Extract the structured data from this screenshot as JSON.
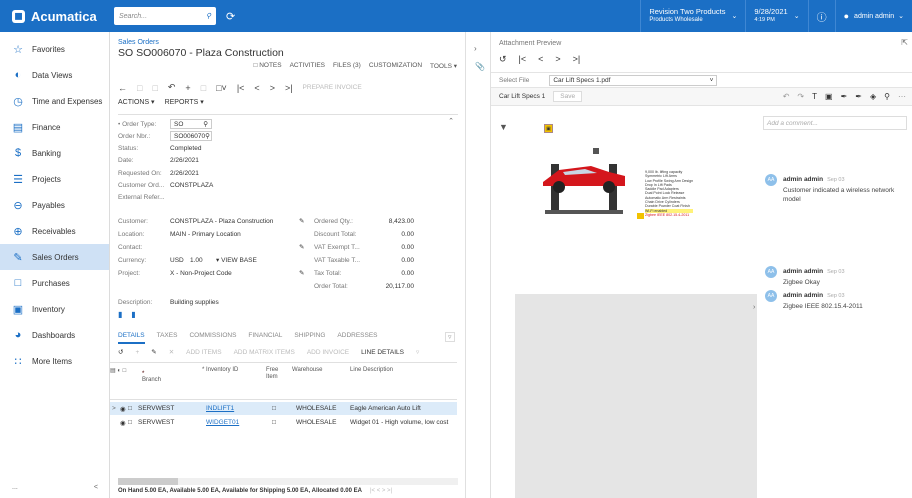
{
  "topbar": {
    "logo": "Acumatica",
    "search_placeholder": "Search...",
    "company_line1": "Revision Two Products",
    "company_line2": "Products Wholesale",
    "date_line1": "9/28/2021",
    "date_line2": "4:19 PM",
    "user": "admin admin"
  },
  "sidebar": {
    "items": [
      {
        "label": "Favorites",
        "icon": "star-icon"
      },
      {
        "label": "Data Views",
        "icon": "data-views-icon"
      },
      {
        "label": "Time and Expenses",
        "icon": "clock-icon"
      },
      {
        "label": "Finance",
        "icon": "finance-icon"
      },
      {
        "label": "Banking",
        "icon": "dollar-icon"
      },
      {
        "label": "Projects",
        "icon": "projects-icon"
      },
      {
        "label": "Payables",
        "icon": "minus-circle-icon"
      },
      {
        "label": "Receivables",
        "icon": "plus-circle-icon"
      },
      {
        "label": "Sales Orders",
        "icon": "edit-icon"
      },
      {
        "label": "Purchases",
        "icon": "cart-icon"
      },
      {
        "label": "Inventory",
        "icon": "truck-icon"
      },
      {
        "label": "Dashboards",
        "icon": "dashboard-icon"
      },
      {
        "label": "More Items",
        "icon": "grid-icon"
      }
    ],
    "footer_dots": "...",
    "collapse": "<"
  },
  "form": {
    "breadcrumb": "Sales Orders",
    "title": "SO SO006070 - Plaza Construction",
    "top_tabs": [
      "NOTES",
      "ACTIVITIES",
      "FILES (3)",
      "CUSTOMIZATION",
      "TOOLS ▾"
    ],
    "toolbar_prepare": "PREPARE INVOICE",
    "menu_actions": "ACTIONS ▾",
    "menu_reports": "REPORTS ▾",
    "order_type_label": "• Order Type:",
    "order_type": "SO",
    "order_nbr_label": "Order Nbr.:",
    "order_nbr": "SO006070",
    "status_label": "Status:",
    "status": "Completed",
    "date_label": "Date:",
    "date": "2/26/2021",
    "requested_label": "Requested On:",
    "requested": "2/26/2021",
    "customer_ord_label": "Customer Ord...",
    "customer_ord": "CONSTPLAZA",
    "external_label": "External Refer...",
    "customer_label": "Customer:",
    "customer": "CONSTPLAZA - Plaza Construction",
    "location_label": "Location:",
    "location": "MAIN - Primary Location",
    "contact_label": "Contact:",
    "currency_label": "Currency:",
    "currency": "USD",
    "rate": "1.00",
    "view_base": "▾ VIEW BASE",
    "project_label": "Project:",
    "project": "X - Non-Project Code",
    "description_label": "Description:",
    "description": "Building supplies",
    "totals": [
      {
        "label": "Ordered Qty.:",
        "value": "8,423.00"
      },
      {
        "label": "Discount Total:",
        "value": "0.00"
      },
      {
        "label": "VAT Exempt T...",
        "value": "0.00"
      },
      {
        "label": "VAT Taxable T...",
        "value": "0.00"
      },
      {
        "label": "Tax Total:",
        "value": "0.00"
      },
      {
        "label": "Order Total:",
        "value": "20,117.00"
      }
    ]
  },
  "grid": {
    "tabs": [
      "DETAILS",
      "TAXES",
      "COMMISSIONS",
      "FINANCIAL",
      "SHIPPING",
      "ADDRESSES"
    ],
    "tools": [
      "ADD ITEMS",
      "ADD MATRIX ITEMS",
      "ADD INVOICE"
    ],
    "line_details": "LINE DETAILS",
    "columns": [
      "* Branch",
      "* Inventory ID",
      "Free Item",
      "Warehouse",
      "Line Description"
    ],
    "rows": [
      {
        "branch": "SERVWEST",
        "inventory": "INDLIFT1",
        "warehouse": "WHOLESALE",
        "desc": "Eagle American Auto Lift"
      },
      {
        "branch": "SERVWEST",
        "inventory": "WIDGET01",
        "warehouse": "WHOLESALE",
        "desc": "Widget 01 - High volume, low cost"
      }
    ],
    "status_bar": "On Hand 5.00 EA, Available 5.00 EA, Available for Shipping 5.00 EA, Allocated 0.00 EA"
  },
  "preview": {
    "title": "Attachment Preview",
    "select_file_label": "Select File",
    "selected_file": "Car Lift Specs 1.pdf",
    "tab": "Car Lift Specs 1",
    "save": "Save",
    "doc_lines": [
      "9,000 lb. lifting capacity",
      "Symmetric Lift Arms",
      "Low Profile Swing Arm Design",
      "Drop In Lift Pads",
      "Saddle Pad Adapters",
      "Dual Point Lock Release",
      "Automatic Arm Restraints",
      "Chain Drive Cylinders",
      "Durable Powder Coat Finish",
      "Wi-Fi enabled",
      "Zigbee IEEE 802.15.4-2011"
    ],
    "add_comment": "Add a comment...",
    "comments": [
      {
        "author": "admin admin",
        "date": "Sep 03",
        "text": "Customer indicated a wireless network model",
        "initials": "AA"
      },
      {
        "author": "admin admin",
        "date": "Sep 03",
        "text": "Zigbee Okay",
        "initials": "AA"
      },
      {
        "author": "admin admin",
        "date": "Sep 03",
        "text": "Zigbee IEEE 802.15.4-2011",
        "initials": "AA"
      }
    ]
  }
}
